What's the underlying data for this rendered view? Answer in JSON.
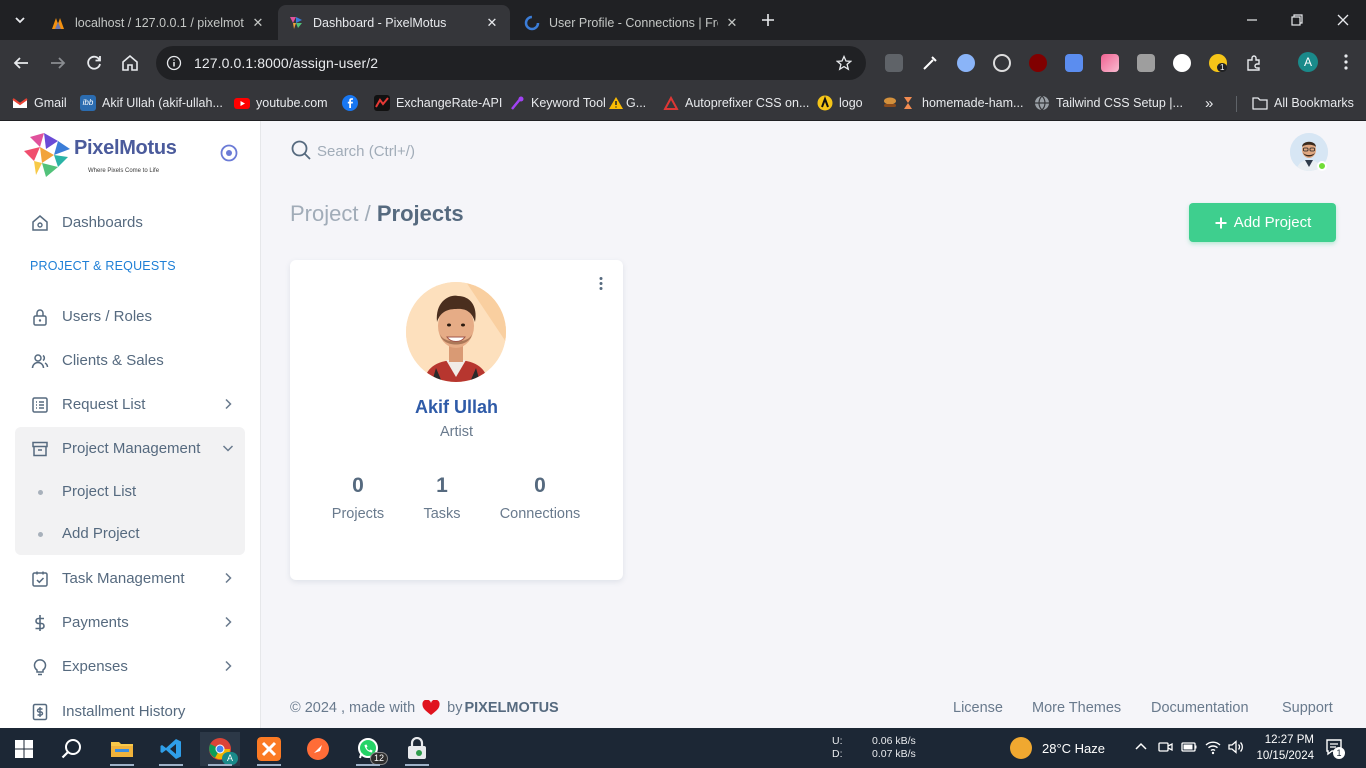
{
  "browser": {
    "tabs": [
      {
        "title": "localhost / 127.0.0.1 / pixelmotus",
        "active": false
      },
      {
        "title": "Dashboard - PixelMotus",
        "active": true
      },
      {
        "title": "User Profile - Connections | Fre",
        "active": false
      }
    ],
    "url": "127.0.0.1:8000/assign-user/2",
    "profile_initial": "A",
    "bookmarks": [
      {
        "label": "Gmail"
      },
      {
        "label": "Akif Ullah (akif-ullah..."
      },
      {
        "label": "youtube.com"
      },
      {
        "label": ""
      },
      {
        "label": "ExchangeRate-API"
      },
      {
        "label": "Keyword Tool"
      },
      {
        "label": "G..."
      },
      {
        "label": "Autoprefixer CSS on..."
      },
      {
        "label": "logo"
      },
      {
        "label": "homemade-ham..."
      },
      {
        "label": "Tailwind CSS Setup |..."
      }
    ],
    "bookmarks_more": "»",
    "all_bookmarks": "All Bookmarks"
  },
  "app": {
    "brand": "PixelMotus",
    "tagline": "Where Pixels Come to Life",
    "sidebar": {
      "dashboards": "Dashboards",
      "section_header": "PROJECT & REQUESTS",
      "items": [
        {
          "label": "Users / Roles"
        },
        {
          "label": "Clients & Sales"
        },
        {
          "label": "Request List"
        },
        {
          "label": "Project Management"
        },
        {
          "label": "Task Management"
        },
        {
          "label": "Payments"
        },
        {
          "label": "Expenses"
        },
        {
          "label": "Installment History"
        }
      ],
      "submenu": [
        {
          "label": "Project List"
        },
        {
          "label": "Add Project"
        }
      ]
    },
    "search": {
      "placeholder": "Search (Ctrl+/)"
    },
    "breadcrumb": {
      "parent": "Project /",
      "current": "Projects"
    },
    "add_button": "Add Project",
    "card": {
      "name": "Akif Ullah",
      "role": "Artist",
      "stats": [
        {
          "value": "0",
          "label": "Projects"
        },
        {
          "value": "1",
          "label": "Tasks"
        },
        {
          "value": "0",
          "label": "Connections"
        }
      ]
    },
    "footer": {
      "copy_prefix": "© 2024 , made with",
      "copy_by": "by",
      "brand": "PIXELMOTUS",
      "links": [
        "License",
        "More Themes",
        "Documentation",
        "Support"
      ]
    }
  },
  "taskbar": {
    "net_up_label": "U:",
    "net_up": "0.06 kB/s",
    "net_down_label": "D:",
    "net_down": "0.07 kB/s",
    "weather": "28°C  Haze",
    "time": "12:27 PM",
    "date": "10/15/2024",
    "whatsapp_badge": "12",
    "chrome_badge": "A",
    "ext_badge": "1",
    "notif_badge": "1"
  },
  "colors": {
    "accent_green": "#3ecf8e",
    "brand_blue": "#2f5ba8",
    "section_header": "#1e7fd6",
    "online": "#71dd37"
  }
}
